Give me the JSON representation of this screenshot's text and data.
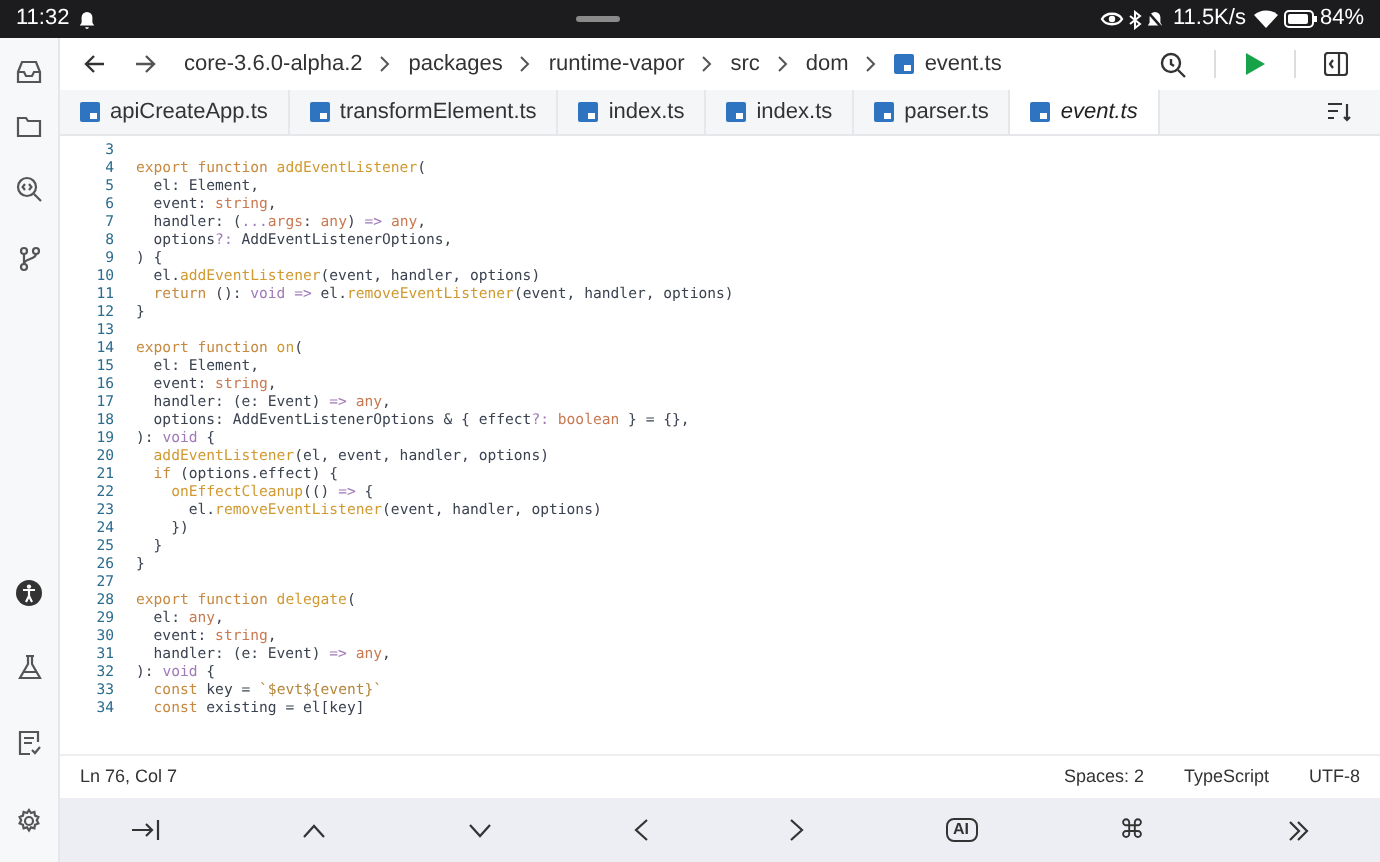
{
  "status_bar": {
    "time": "11:32",
    "speed": "11.5K/s",
    "battery": "84%"
  },
  "breadcrumb": [
    "core-3.6.0-alpha.2",
    "packages",
    "runtime-vapor",
    "src",
    "dom",
    "event.ts"
  ],
  "tabs": [
    {
      "label": "apiCreateApp.ts",
      "selected": false
    },
    {
      "label": "transformElement.ts",
      "selected": false
    },
    {
      "label": "index.ts",
      "selected": false
    },
    {
      "label": "index.ts",
      "selected": false
    },
    {
      "label": "parser.ts",
      "selected": false
    },
    {
      "label": "event.ts",
      "selected": true
    }
  ],
  "code_lines": [
    {
      "number": "3"
    },
    {
      "number": "4",
      "tokens": [
        {
          "kind": "kw",
          "text": "export function "
        },
        {
          "kind": "fn",
          "text": "addEventListener"
        },
        {
          "kind": "plain",
          "text": "("
        }
      ]
    },
    {
      "number": "5",
      "tokens": [
        {
          "kind": "plain",
          "text": "  el: Element,"
        }
      ]
    },
    {
      "number": "6",
      "tokens": [
        {
          "kind": "plain",
          "text": "  event: "
        },
        {
          "kind": "type",
          "text": "string"
        },
        {
          "kind": "plain",
          "text": ","
        }
      ]
    },
    {
      "number": "7",
      "tokens": [
        {
          "kind": "plain",
          "text": "  handler: ("
        },
        {
          "kind": "op",
          "text": "..."
        },
        {
          "kind": "type",
          "text": "args"
        },
        {
          "kind": "plain",
          "text": ": "
        },
        {
          "kind": "type",
          "text": "any"
        },
        {
          "kind": "plain",
          "text": ") "
        },
        {
          "kind": "op",
          "text": "=> "
        },
        {
          "kind": "type",
          "text": "any"
        },
        {
          "kind": "plain",
          "text": ","
        }
      ]
    },
    {
      "number": "8",
      "tokens": [
        {
          "kind": "plain",
          "text": "  options"
        },
        {
          "kind": "op",
          "text": "?:"
        },
        {
          "kind": "plain",
          "text": " AddEventListenerOptions,"
        }
      ]
    },
    {
      "number": "9",
      "tokens": [
        {
          "kind": "plain",
          "text": ") {"
        }
      ]
    },
    {
      "number": "10",
      "tokens": [
        {
          "kind": "plain",
          "text": "  el."
        },
        {
          "kind": "fn",
          "text": "addEventListener"
        },
        {
          "kind": "plain",
          "text": "(event, handler, options)"
        }
      ]
    },
    {
      "number": "11",
      "tokens": [
        {
          "kind": "kw",
          "text": "  return"
        },
        {
          "kind": "plain",
          "text": " (): "
        },
        {
          "kind": "op",
          "text": "void => "
        },
        {
          "kind": "plain",
          "text": "el."
        },
        {
          "kind": "fn",
          "text": "removeEventListener"
        },
        {
          "kind": "plain",
          "text": "(event, handler, options)"
        }
      ]
    },
    {
      "number": "12",
      "tokens": [
        {
          "kind": "plain",
          "text": "}"
        }
      ]
    },
    {
      "number": "13"
    },
    {
      "number": "14",
      "tokens": [
        {
          "kind": "kw",
          "text": "export function "
        },
        {
          "kind": "fn",
          "text": "on"
        },
        {
          "kind": "plain",
          "text": "("
        }
      ]
    },
    {
      "number": "15",
      "tokens": [
        {
          "kind": "plain",
          "text": "  el: Element,"
        }
      ]
    },
    {
      "number": "16",
      "tokens": [
        {
          "kind": "plain",
          "text": "  event: "
        },
        {
          "kind": "type",
          "text": "string"
        },
        {
          "kind": "plain",
          "text": ","
        }
      ]
    },
    {
      "number": "17",
      "tokens": [
        {
          "kind": "plain",
          "text": "  handler: (e: Event) "
        },
        {
          "kind": "op",
          "text": "=> "
        },
        {
          "kind": "type",
          "text": "any"
        },
        {
          "kind": "plain",
          "text": ","
        }
      ]
    },
    {
      "number": "18",
      "tokens": [
        {
          "kind": "plain",
          "text": "  options: AddEventListenerOptions & { effect"
        },
        {
          "kind": "op",
          "text": "?: "
        },
        {
          "kind": "type",
          "text": "boolean"
        },
        {
          "kind": "plain",
          "text": " } = {},"
        }
      ]
    },
    {
      "number": "19",
      "tokens": [
        {
          "kind": "plain",
          "text": "): "
        },
        {
          "kind": "op",
          "text": "void"
        },
        {
          "kind": "plain",
          "text": " {"
        }
      ]
    },
    {
      "number": "20",
      "tokens": [
        {
          "kind": "fn",
          "text": "  addEventListener"
        },
        {
          "kind": "plain",
          "text": "(el, event, handler, options)"
        }
      ]
    },
    {
      "number": "21",
      "tokens": [
        {
          "kind": "kw",
          "text": "  if"
        },
        {
          "kind": "plain",
          "text": " (options.effect) {"
        }
      ]
    },
    {
      "number": "22",
      "tokens": [
        {
          "kind": "fn",
          "text": "    onEffectCleanup"
        },
        {
          "kind": "plain",
          "text": "(() "
        },
        {
          "kind": "op",
          "text": "=>"
        },
        {
          "kind": "plain",
          "text": " {"
        }
      ]
    },
    {
      "number": "23",
      "tokens": [
        {
          "kind": "plain",
          "text": "      el."
        },
        {
          "kind": "fn",
          "text": "removeEventListener"
        },
        {
          "kind": "plain",
          "text": "(event, handler, options)"
        }
      ]
    },
    {
      "number": "24",
      "tokens": [
        {
          "kind": "plain",
          "text": "    })"
        }
      ]
    },
    {
      "number": "25",
      "tokens": [
        {
          "kind": "plain",
          "text": "  }"
        }
      ]
    },
    {
      "number": "26",
      "tokens": [
        {
          "kind": "plain",
          "text": "}"
        }
      ]
    },
    {
      "number": "27"
    },
    {
      "number": "28",
      "tokens": [
        {
          "kind": "kw",
          "text": "export function "
        },
        {
          "kind": "fn",
          "text": "delegate"
        },
        {
          "kind": "plain",
          "text": "("
        }
      ]
    },
    {
      "number": "29",
      "tokens": [
        {
          "kind": "plain",
          "text": "  el: "
        },
        {
          "kind": "type",
          "text": "any"
        },
        {
          "kind": "plain",
          "text": ","
        }
      ]
    },
    {
      "number": "30",
      "tokens": [
        {
          "kind": "plain",
          "text": "  event: "
        },
        {
          "kind": "type",
          "text": "string"
        },
        {
          "kind": "plain",
          "text": ","
        }
      ]
    },
    {
      "number": "31",
      "tokens": [
        {
          "kind": "plain",
          "text": "  handler: (e: Event) "
        },
        {
          "kind": "op",
          "text": "=> "
        },
        {
          "kind": "type",
          "text": "any"
        },
        {
          "kind": "plain",
          "text": ","
        }
      ]
    },
    {
      "number": "32",
      "tokens": [
        {
          "kind": "plain",
          "text": "): "
        },
        {
          "kind": "op",
          "text": "void"
        },
        {
          "kind": "plain",
          "text": " {"
        }
      ]
    },
    {
      "number": "33",
      "tokens": [
        {
          "kind": "kw",
          "text": "  const"
        },
        {
          "kind": "plain",
          "text": " key = "
        },
        {
          "kind": "str",
          "text": "`$evt${event}`"
        }
      ]
    },
    {
      "number": "34",
      "tokens": [
        {
          "kind": "kw",
          "text": "  const"
        },
        {
          "kind": "plain",
          "text": " existing = el[key]"
        }
      ]
    }
  ],
  "editor_status": {
    "position": "Ln 76, Col 7",
    "indent": "Spaces: 2",
    "language": "TypeScript",
    "encoding": "UTF-8"
  },
  "bottom_toolbar": {
    "ai_label": "AI",
    "command_label": "⌘"
  }
}
